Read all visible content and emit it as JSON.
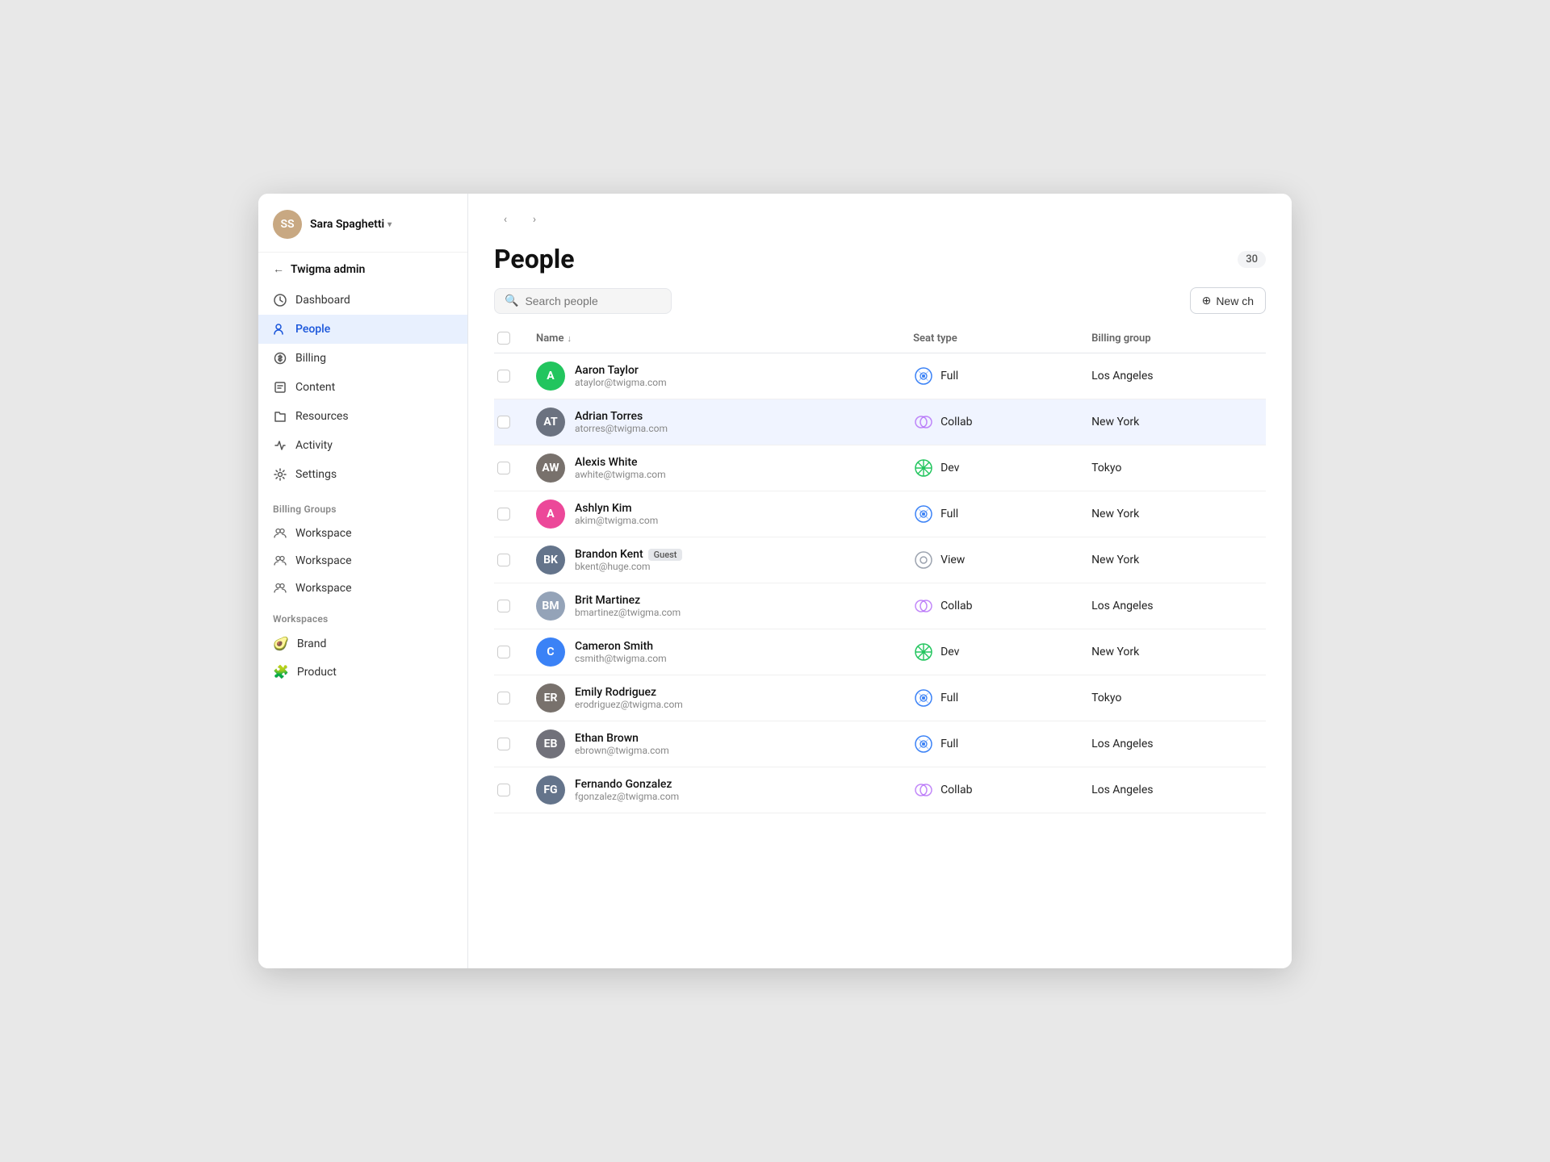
{
  "app": {
    "user": "Sara Spaghetti",
    "admin_label": "Twigma admin",
    "back_arrow": "←"
  },
  "sidebar": {
    "nav_items": [
      {
        "id": "dashboard",
        "label": "Dashboard",
        "icon": "dashboard"
      },
      {
        "id": "people",
        "label": "People",
        "icon": "people",
        "active": true
      },
      {
        "id": "billing",
        "label": "Billing",
        "icon": "billing"
      },
      {
        "id": "content",
        "label": "Content",
        "icon": "content"
      },
      {
        "id": "resources",
        "label": "Resources",
        "icon": "resources"
      },
      {
        "id": "activity",
        "label": "Activity",
        "icon": "activity"
      },
      {
        "id": "settings",
        "label": "Settings",
        "icon": "settings"
      }
    ],
    "billing_groups_label": "Billing Groups",
    "billing_groups": [
      {
        "label": "Workspace",
        "icon": "group"
      },
      {
        "label": "Workspace",
        "icon": "group"
      },
      {
        "label": "Workspace",
        "icon": "group"
      }
    ],
    "workspaces_label": "Workspaces",
    "workspaces": [
      {
        "label": "Brand",
        "emoji": "🥑"
      },
      {
        "label": "Product",
        "emoji": "🧩"
      }
    ]
  },
  "main": {
    "page_title": "People",
    "people_count": "30",
    "search_placeholder": "Search people",
    "new_charge_label": "New ch",
    "table": {
      "columns": [
        "",
        "Name",
        "Seat type",
        "Billing group"
      ],
      "rows": [
        {
          "id": 1,
          "name": "Aaron Taylor",
          "email": "ataylor@twigma.com",
          "seat_type": "Full",
          "billing_group": "Los Angeles",
          "avatar_color": "#22c55e",
          "avatar_letter": "A",
          "avatar_img": ""
        },
        {
          "id": 2,
          "name": "Adrian Torres",
          "email": "atorres@twigma.com",
          "seat_type": "Collab",
          "billing_group": "New York",
          "avatar_color": "",
          "avatar_letter": "",
          "avatar_img": "adrian",
          "highlighted": true
        },
        {
          "id": 3,
          "name": "Alexis White",
          "email": "awhite@twigma.com",
          "seat_type": "Dev",
          "billing_group": "Tokyo",
          "avatar_color": "",
          "avatar_letter": "",
          "avatar_img": "alexis"
        },
        {
          "id": 4,
          "name": "Ashlyn Kim",
          "email": "akim@twigma.com",
          "seat_type": "Full",
          "billing_group": "New York",
          "avatar_color": "#ec4899",
          "avatar_letter": "A",
          "avatar_img": ""
        },
        {
          "id": 5,
          "name": "Brandon Kent",
          "email": "bkent@huge.com",
          "seat_type": "View",
          "billing_group": "New York",
          "avatar_color": "",
          "avatar_letter": "",
          "avatar_img": "brandon",
          "guest": true
        },
        {
          "id": 6,
          "name": "Brit Martinez",
          "email": "bmartinez@twigma.com",
          "seat_type": "Collab",
          "billing_group": "Los Angeles",
          "avatar_color": "",
          "avatar_letter": "",
          "avatar_img": "brit"
        },
        {
          "id": 7,
          "name": "Cameron Smith",
          "email": "csmith@twigma.com",
          "seat_type": "Dev",
          "billing_group": "New York",
          "avatar_color": "#3b82f6",
          "avatar_letter": "C",
          "avatar_img": ""
        },
        {
          "id": 8,
          "name": "Emily Rodriguez",
          "email": "erodriguez@twigma.com",
          "seat_type": "Full",
          "billing_group": "Tokyo",
          "avatar_color": "",
          "avatar_letter": "",
          "avatar_img": "emily"
        },
        {
          "id": 9,
          "name": "Ethan Brown",
          "email": "ebrown@twigma.com",
          "seat_type": "Full",
          "billing_group": "Los Angeles",
          "avatar_color": "",
          "avatar_letter": "",
          "avatar_img": "ethan"
        },
        {
          "id": 10,
          "name": "Fernando Gonzalez",
          "email": "fgonzalez@twigma.com",
          "seat_type": "Collab",
          "billing_group": "Los Angeles",
          "avatar_color": "",
          "avatar_letter": "",
          "avatar_img": "fernando"
        }
      ]
    }
  }
}
